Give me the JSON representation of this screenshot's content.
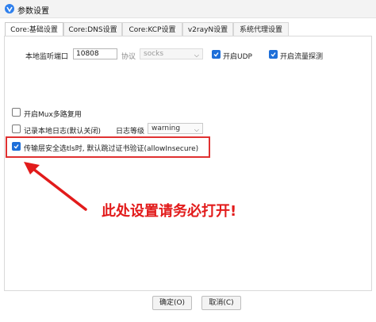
{
  "window": {
    "title": "参数设置"
  },
  "tabs": [
    {
      "label": "Core:基础设置",
      "active": true
    },
    {
      "label": "Core:DNS设置",
      "active": false
    },
    {
      "label": "Core:KCP设置",
      "active": false
    },
    {
      "label": "v2rayN设置",
      "active": false
    },
    {
      "label": "系统代理设置",
      "active": false
    }
  ],
  "basic": {
    "listen_port_label": "本地监听端口",
    "listen_port_value": "10808",
    "protocol_label": "协议",
    "protocol_value": "socks",
    "enable_udp_label": "开启UDP",
    "enable_udp_checked": true,
    "enable_sniffing_label": "开启流量探测",
    "enable_sniffing_checked": true,
    "mux_label": "开启Mux多路复用",
    "mux_checked": false,
    "log_label": "记录本地日志(默认关闭)",
    "log_checked": false,
    "log_level_label": "日志等级",
    "log_level_value": "warning",
    "allow_insecure_label": "传输层安全选tls时, 默认跳过证书验证(allowInsecure)",
    "allow_insecure_checked": true
  },
  "annotation": {
    "text": "此处设置请务必打开!",
    "color": "#e21b1b"
  },
  "footer": {
    "ok_label": "确定(O)",
    "cancel_label": "取消(C)"
  },
  "colors": {
    "accent": "#1e6fd9",
    "highlight": "#e03131"
  },
  "icons": {
    "app": "v2rayN-logo-icon",
    "check": "check-icon",
    "dropdown": "chevron-down-icon",
    "arrow": "red-arrow-icon"
  }
}
